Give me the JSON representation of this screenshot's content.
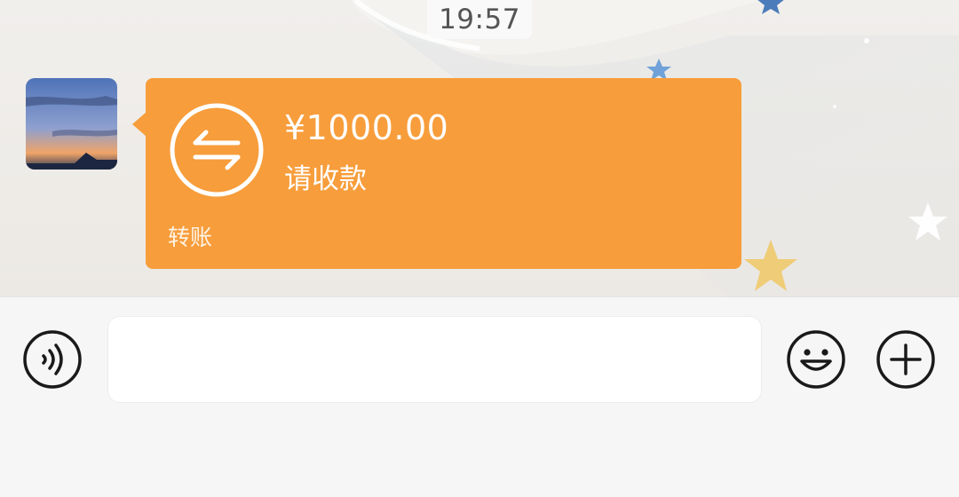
{
  "chat": {
    "timestamp": "19:57",
    "transfer": {
      "amount": "¥1000.00",
      "status": "请收款",
      "label": "转账",
      "color": "#f79d3b"
    }
  },
  "input_bar": {
    "text_value": "",
    "icons": [
      "voice-icon",
      "emoji-icon",
      "plus-icon"
    ]
  }
}
